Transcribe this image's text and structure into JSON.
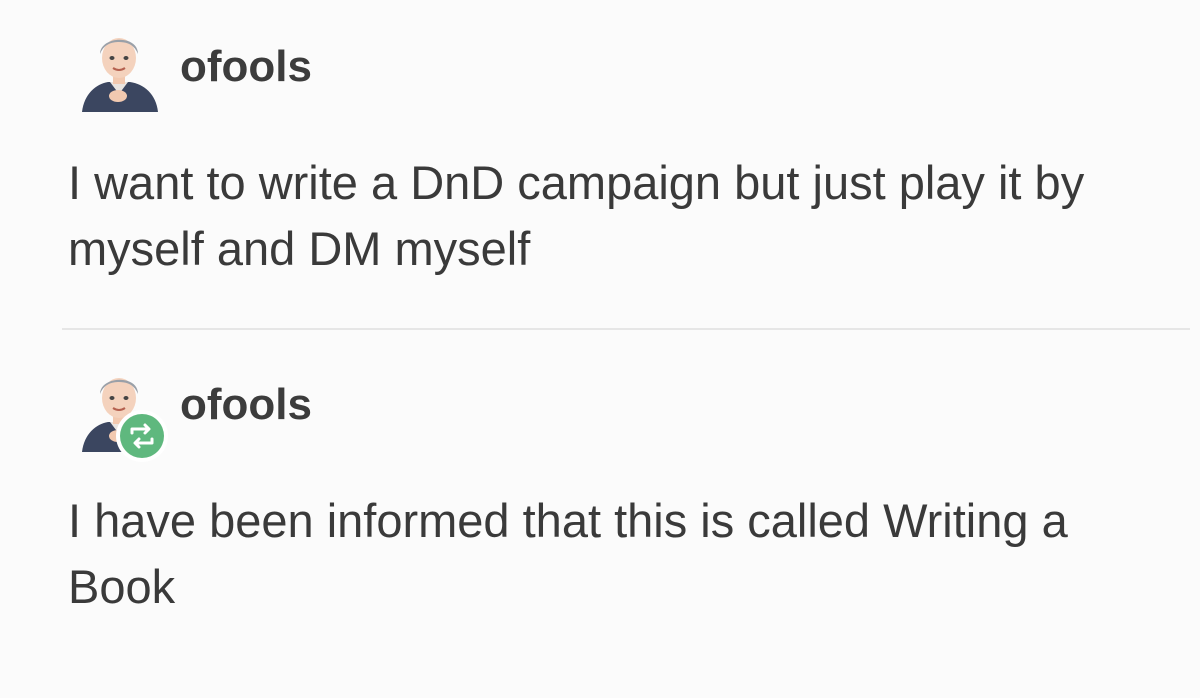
{
  "posts": [
    {
      "username": "ofools",
      "text": "I want to write a DnD campaign but just play it by myself and DM myself",
      "avatar_icon": "user-avatar-icon",
      "reblog": false
    },
    {
      "username": "ofools",
      "text": "I have been informed that this is called Writing a Book",
      "avatar_icon": "user-avatar-icon",
      "reblog": true,
      "reblog_icon": "reblog-icon",
      "reblog_color": "#5fb87e"
    }
  ]
}
